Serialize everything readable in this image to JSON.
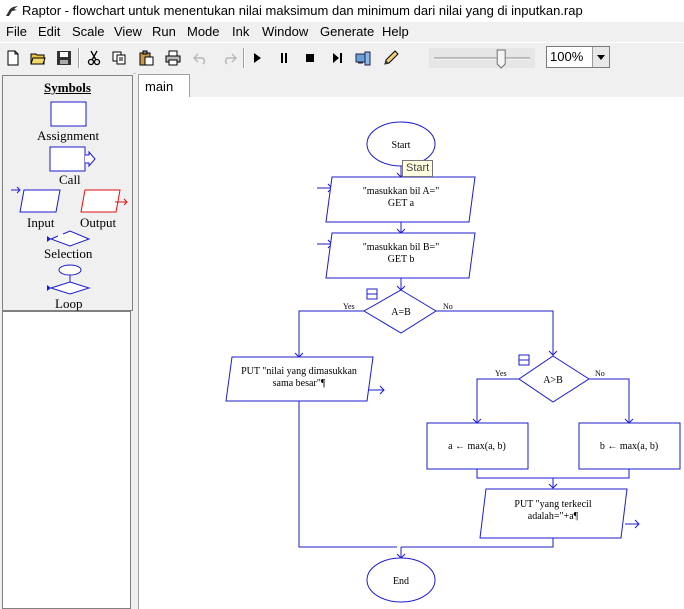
{
  "window": {
    "title": "Raptor - flowchart untuk menentukan nilai maksimum dan minimum dari nilai yang di inputkan.rap"
  },
  "menu": [
    "File",
    "Edit",
    "Scale",
    "View",
    "Run",
    "Mode",
    "Ink",
    "Window",
    "Generate",
    "Help"
  ],
  "toolbar": {
    "icons": [
      "new-file-icon",
      "open-folder-icon",
      "save-icon",
      "cut-icon",
      "copy-icon",
      "paste-icon",
      "print-icon",
      "undo-icon",
      "redo-icon",
      "play-icon",
      "pause-icon",
      "stop-icon",
      "step-icon",
      "test-server-icon",
      "pen-icon"
    ],
    "speed_level": 0.7,
    "zoom": "100%"
  },
  "symbols": {
    "title": "Symbols",
    "assignment": "Assignment",
    "call": "Call",
    "input": "Input",
    "output": "Output",
    "selection": "Selection",
    "loop": "Loop"
  },
  "tabs": [
    "main"
  ],
  "tooltip": "Start",
  "flowchart": {
    "start": "Start",
    "input1_line1": "\"masukkan bil A=\"",
    "input1_line2": "GET a",
    "input2_line1": "\"masukkan bil B=\"",
    "input2_line2": "GET b",
    "cond1": "A=B",
    "cond1_yes": "Yes",
    "cond1_no": "No",
    "output1_line1": "PUT \"nilai yang dimasukkan",
    "output1_line2": "sama besar\"¶",
    "cond2": "A>B",
    "cond2_yes": "Yes",
    "cond2_no": "No",
    "assign_left": "a ← max(a, b)",
    "assign_right": "b ← max(a, b)",
    "output2_line1": "PUT \"yang terkecil",
    "output2_line2": "adalah=\"+a¶",
    "end": "End"
  },
  "colors": {
    "flow_blue": "#1c1ccc",
    "output_red": "#dd1111",
    "tooltip_bg": "#ffffe1"
  }
}
